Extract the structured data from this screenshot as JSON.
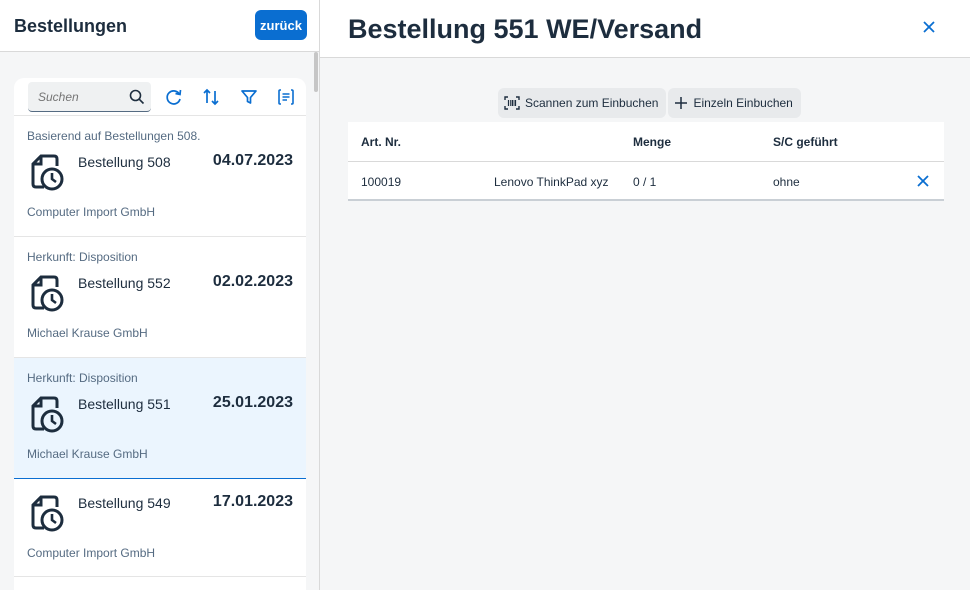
{
  "master": {
    "title": "Bestellungen",
    "back_label": "zurück",
    "search_placeholder": "Suchen",
    "items": [
      {
        "top": "Basierend auf Bestellungen 508.",
        "name": "Bestellung 508",
        "date": "04.07.2023",
        "supplier": "Computer Import GmbH"
      },
      {
        "top": "Herkunft: Disposition",
        "name": "Bestellung 552",
        "date": "02.02.2023",
        "supplier": "Michael Krause GmbH"
      },
      {
        "top": "Herkunft: Disposition",
        "name": "Bestellung 551",
        "date": "25.01.2023",
        "supplier": "Michael Krause GmbH"
      },
      {
        "top": "",
        "name": "Bestellung 549",
        "date": "17.01.2023",
        "supplier": "Computer Import GmbH"
      }
    ]
  },
  "detail": {
    "title": "Bestellung 551 WE/Versand",
    "scan_label": "Scannen zum Einbuchen",
    "single_label": "Einzeln Einbuchen",
    "columns": {
      "art": "Art. Nr.",
      "menge": "Menge",
      "sc": "S/C geführt"
    },
    "rows": [
      {
        "art": "100019",
        "desc": "Lenovo ThinkPad xyz",
        "menge": "0 / 1",
        "sc": "ohne"
      }
    ]
  },
  "colors": {
    "accent": "#0a6ed1",
    "selected_bg": "#ebf5fe",
    "text": "#1d2d3e"
  }
}
